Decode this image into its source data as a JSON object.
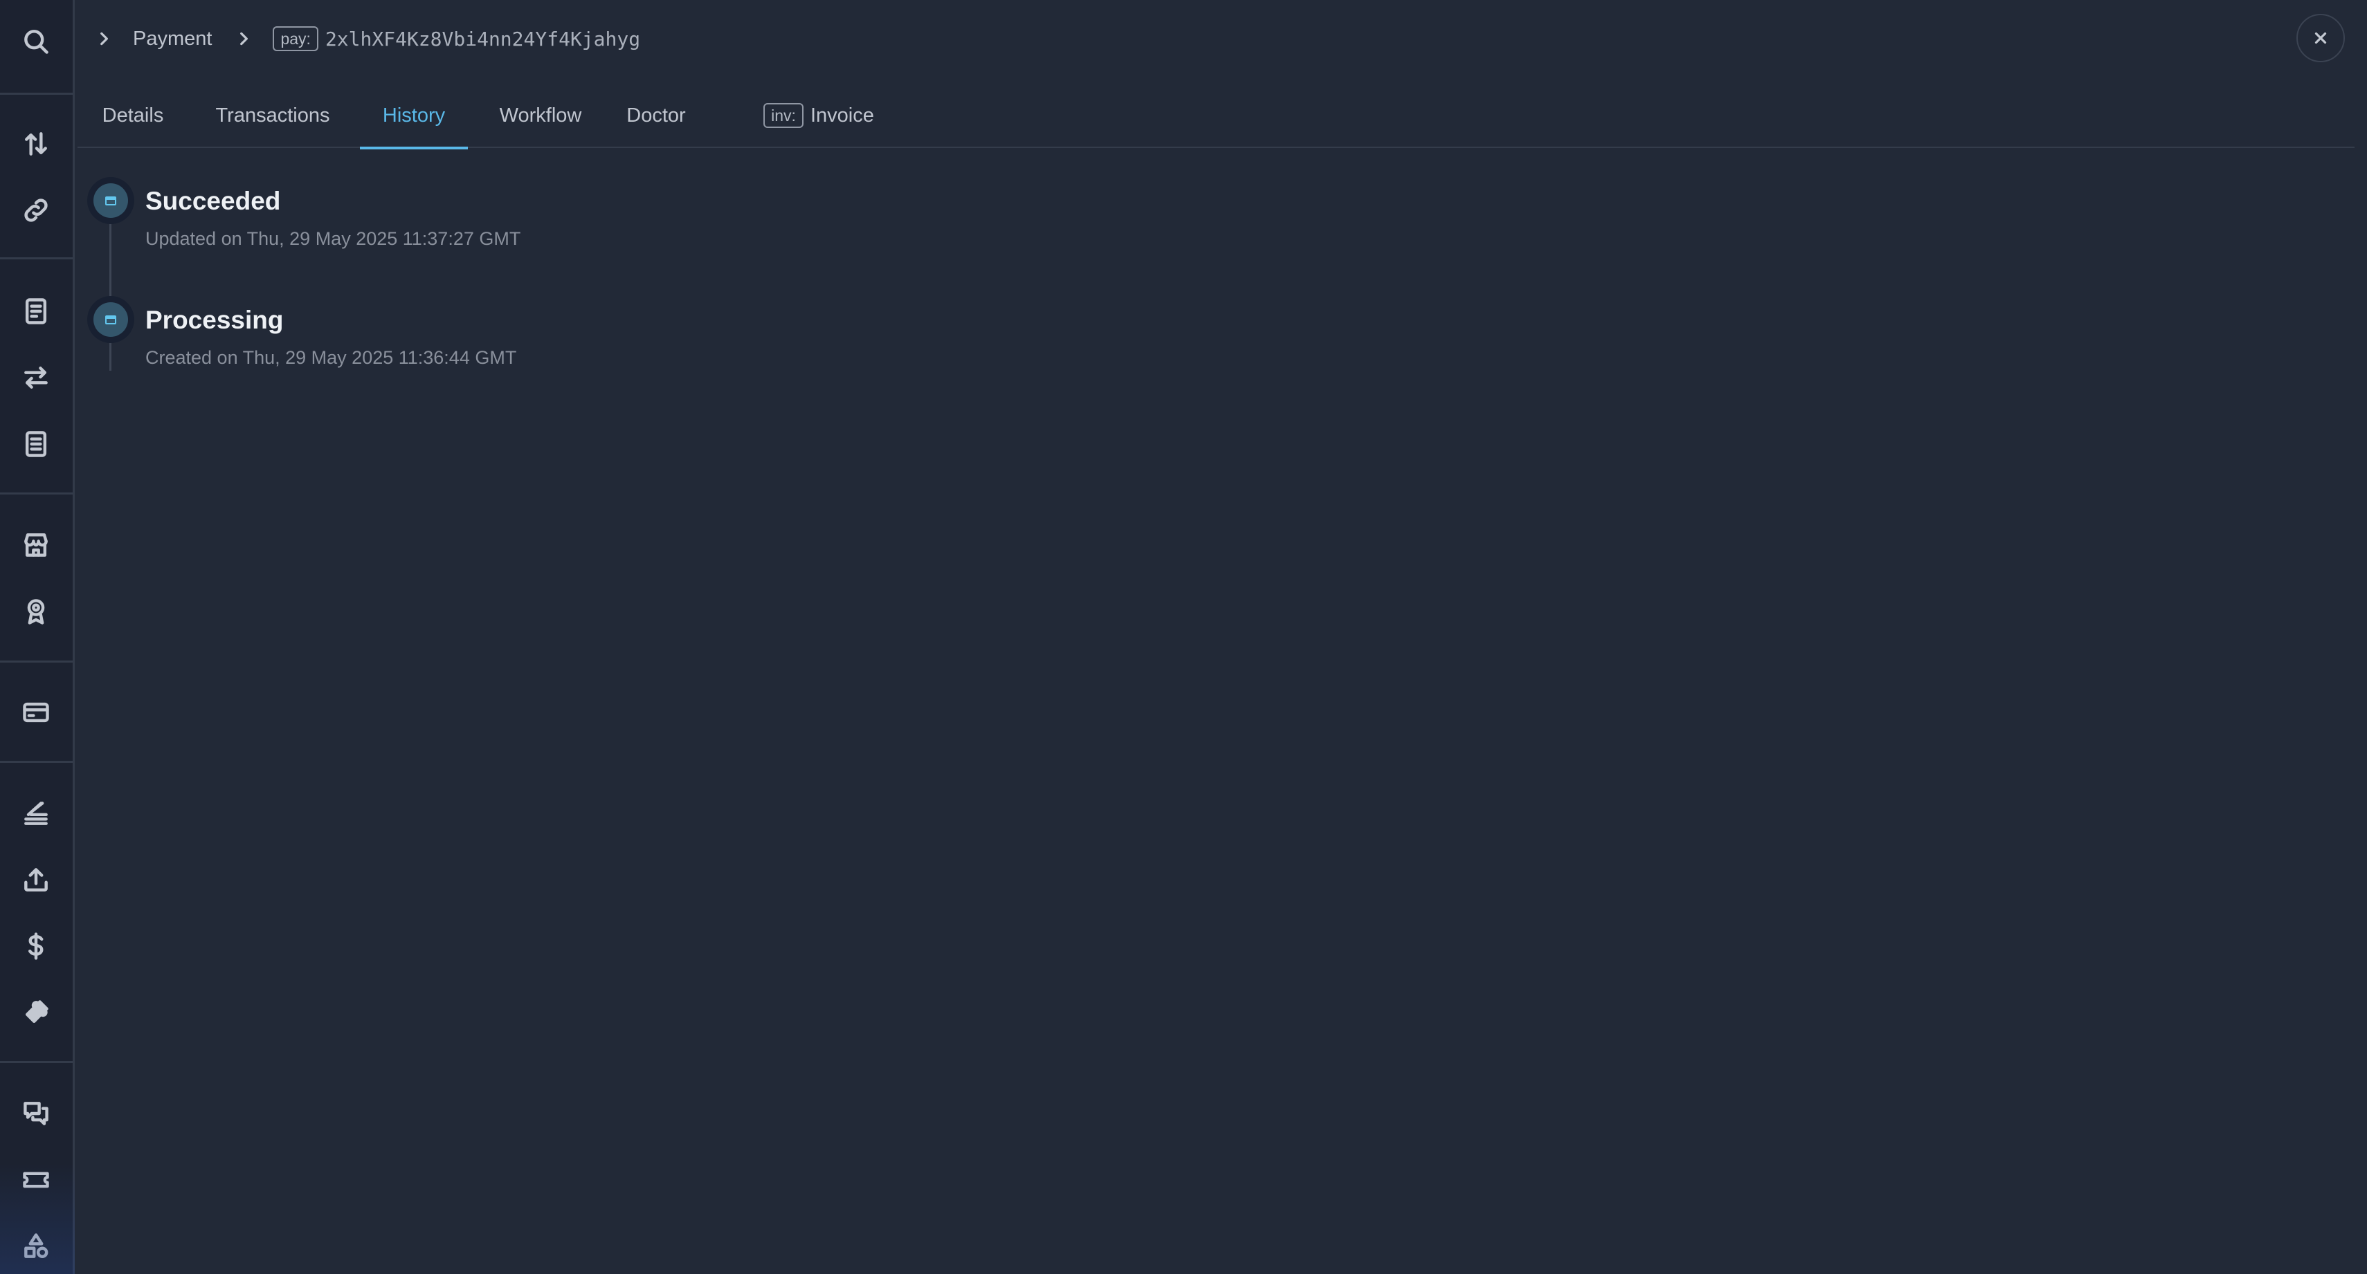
{
  "breadcrumb": {
    "parent": "Payment",
    "id_prefix": "pay:",
    "id_value": "2xlhXF4Kz8Vbi4nn24Yf4Kjahyg"
  },
  "tabs": [
    {
      "label": "Details"
    },
    {
      "label": "Transactions"
    },
    {
      "label": "History",
      "active": true
    },
    {
      "label": "Workflow"
    },
    {
      "label": "Doctor"
    },
    {
      "label": "Invoice",
      "badge": "inv:"
    }
  ],
  "timeline": [
    {
      "status": "Succeeded",
      "detail": "Updated on Thu, 29 May 2025 11:37:27 GMT",
      "icon": "receipt-icon"
    },
    {
      "status": "Processing",
      "detail": "Created on Thu, 29 May 2025 11:36:44 GMT",
      "icon": "receipt-icon"
    }
  ],
  "sidebar": {
    "icons": [
      "search-icon",
      "transfer-icon",
      "link-icon",
      "receipt-icon",
      "exchange-icon",
      "receipt-alt-icon",
      "store-icon",
      "award-icon",
      "card-icon",
      "stack-icon",
      "upload-icon",
      "dollar-icon",
      "puzzle-icon",
      "chat-icon",
      "ticket-icon",
      "shapes-icon"
    ]
  },
  "colors": {
    "background": "#222937",
    "sidebar": "#1c2230",
    "accent": "#5ab8e8"
  }
}
